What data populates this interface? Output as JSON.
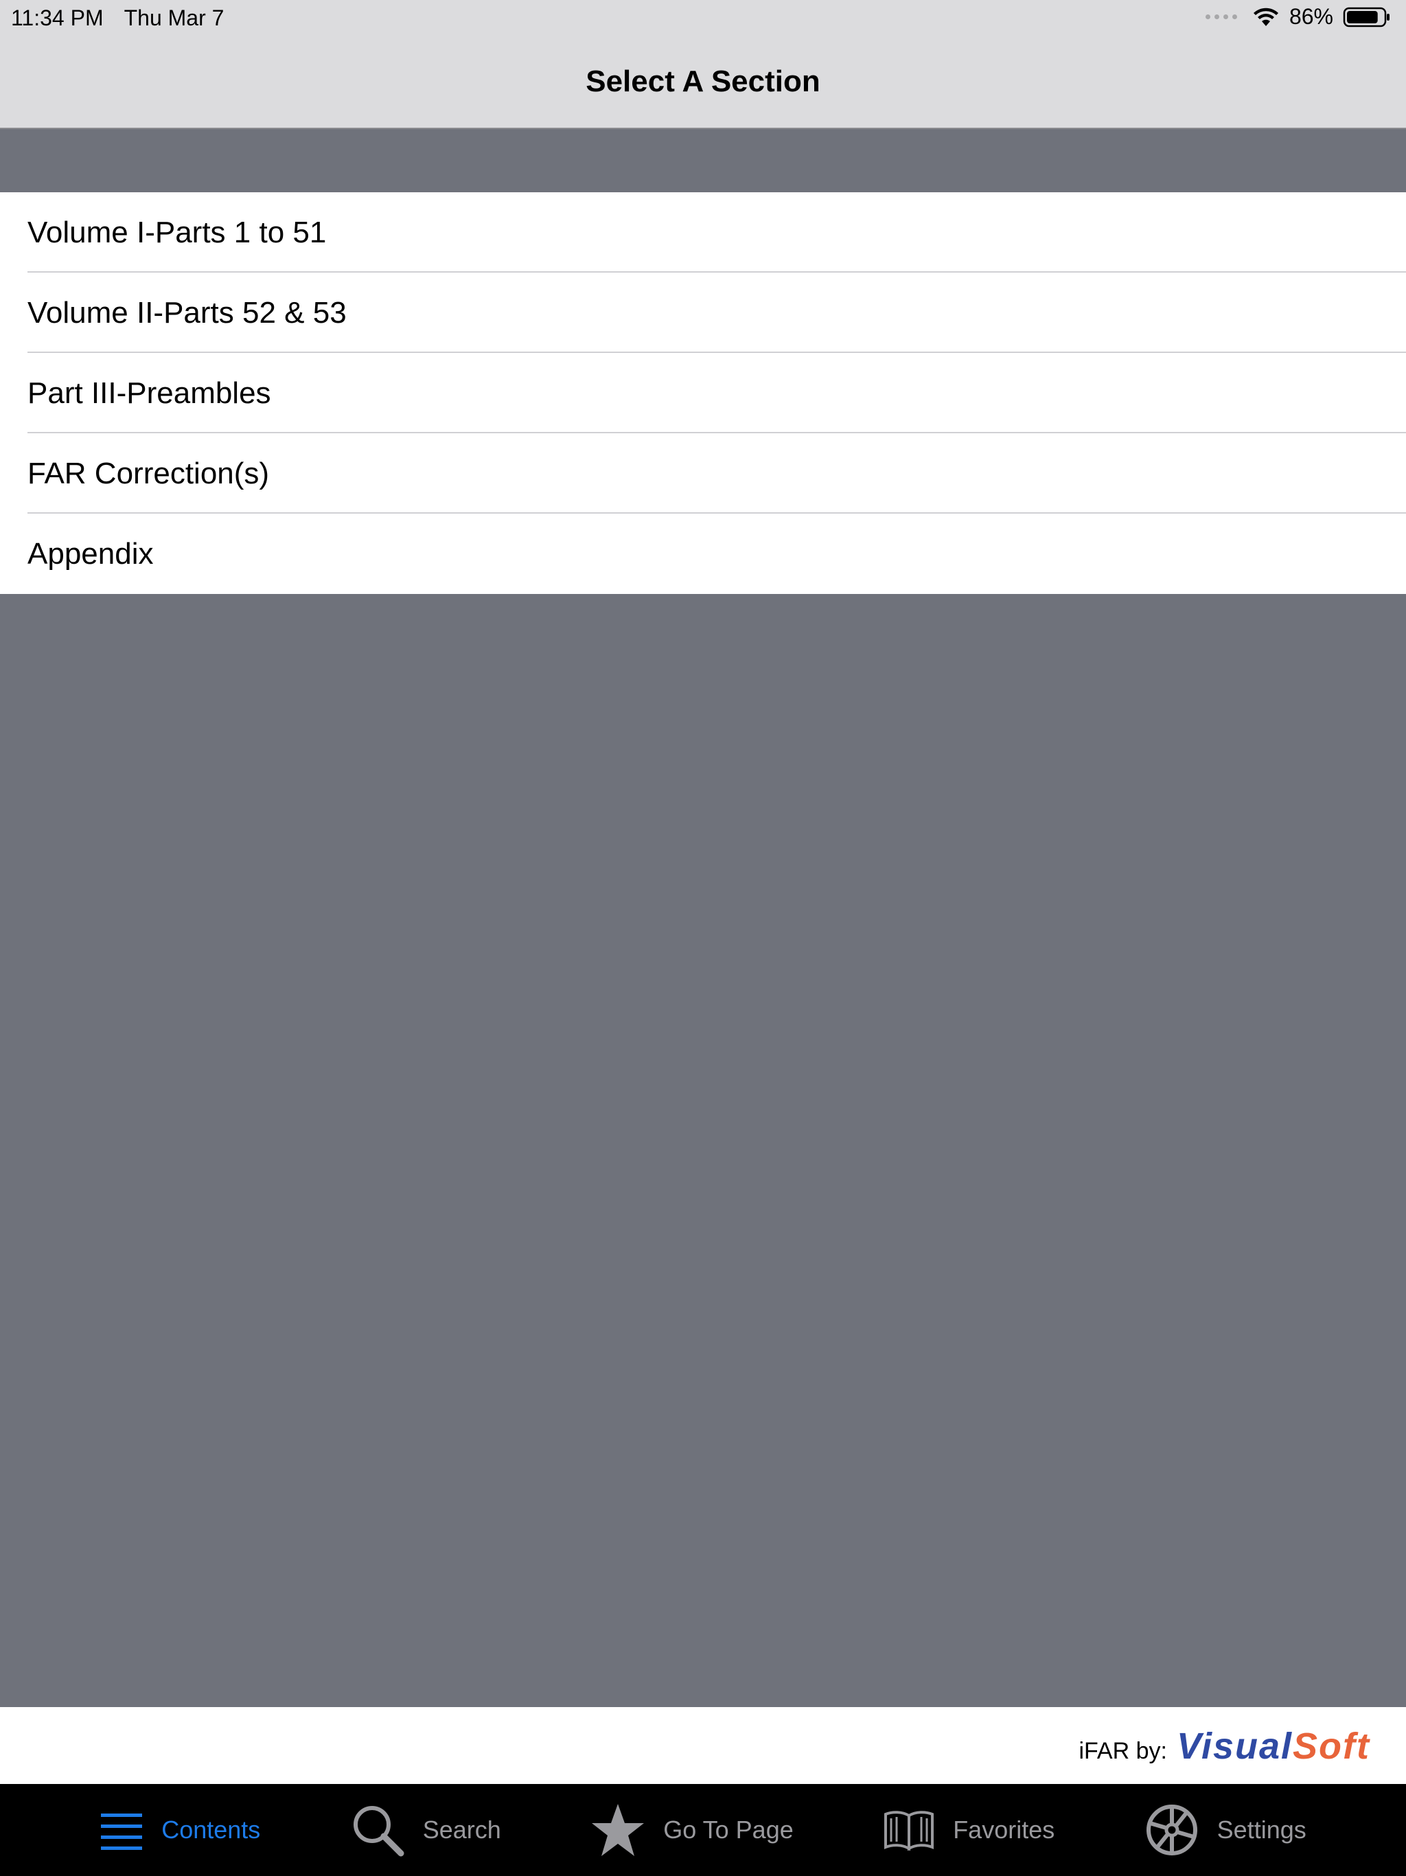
{
  "status_bar": {
    "time": "11:34 PM",
    "date": "Thu Mar 7",
    "battery": "86%",
    "battery_level": 0.86
  },
  "nav": {
    "title": "Select A Section"
  },
  "sections": [
    {
      "label": "Volume I-Parts 1 to 51"
    },
    {
      "label": "Volume II-Parts 52 & 53"
    },
    {
      "label": "Part III-Preambles"
    },
    {
      "label": "FAR Correction(s)"
    },
    {
      "label": "Appendix"
    }
  ],
  "credit": {
    "label": "iFAR by:",
    "brand_part1": "Visual",
    "brand_part2": "Soft",
    "brand_colors": {
      "visual": "#2f4aa3",
      "soft": "#e8643a"
    }
  },
  "tabs": [
    {
      "label": "Contents",
      "icon": "list-icon",
      "active": true
    },
    {
      "label": "Search",
      "icon": "search-icon",
      "active": false
    },
    {
      "label": "Go To Page",
      "icon": "star-icon",
      "active": false
    },
    {
      "label": "Favorites",
      "icon": "book-icon",
      "active": false
    },
    {
      "label": "Settings",
      "icon": "gear-wheel-icon",
      "active": false
    }
  ],
  "colors": {
    "accent": "#1d7be8",
    "background": "#6f727b",
    "tab_inactive": "#9a9a9e"
  }
}
